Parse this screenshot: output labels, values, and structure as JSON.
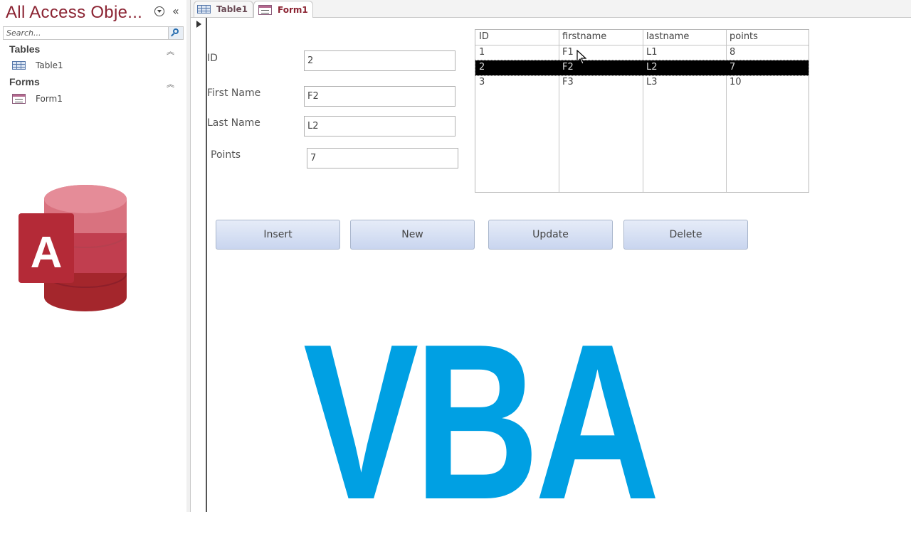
{
  "navigation_pane": {
    "title": "All Access Obje...",
    "search_placeholder": "Search...",
    "collapse_glyph": "«",
    "groups": [
      {
        "label": "Tables",
        "chevron": "︽",
        "items": [
          {
            "label": "Table1",
            "icon": "table-icon"
          }
        ]
      },
      {
        "label": "Forms",
        "chevron": "︽",
        "items": [
          {
            "label": "Form1",
            "icon": "form-icon"
          }
        ]
      }
    ]
  },
  "tabs": [
    {
      "label": "Table1",
      "icon": "table-icon",
      "active": false
    },
    {
      "label": "Form1",
      "icon": "form-icon",
      "active": true
    }
  ],
  "form": {
    "fields": [
      {
        "label": "ID",
        "value": "2"
      },
      {
        "label": "First Name",
        "value": "F2"
      },
      {
        "label": "Last Name",
        "value": "L2"
      },
      {
        "label": "Points",
        "value": "7"
      }
    ],
    "listbox": {
      "columns": [
        "ID",
        "firstname",
        "lastname",
        "points"
      ],
      "rows": [
        [
          "1",
          "F1",
          "L1",
          "8"
        ],
        [
          "2",
          "F2",
          "L2",
          "7"
        ],
        [
          "3",
          "F3",
          "L3",
          "10"
        ]
      ],
      "selected_row_index": 1
    },
    "buttons": [
      "Insert",
      "New",
      "Update",
      "Delete"
    ]
  },
  "overlay": {
    "vba_text": "VBA",
    "vba_color": "#00a0e3",
    "logo_letter": "A",
    "logo_color": "#a4262c"
  }
}
